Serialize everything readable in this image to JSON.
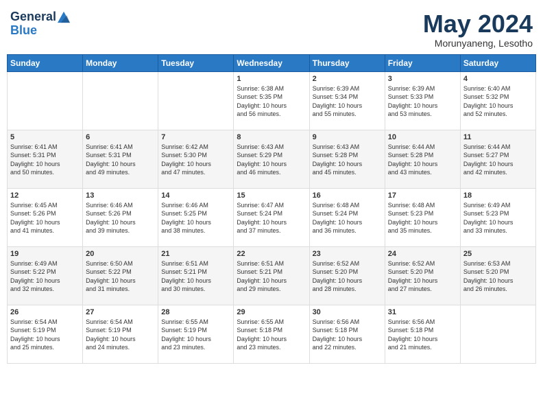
{
  "logo": {
    "line1": "General",
    "line2": "Blue"
  },
  "title": {
    "month_year": "May 2024",
    "location": "Morunyaneng, Lesotho"
  },
  "days_of_week": [
    "Sunday",
    "Monday",
    "Tuesday",
    "Wednesday",
    "Thursday",
    "Friday",
    "Saturday"
  ],
  "weeks": [
    [
      {
        "day": "",
        "info": ""
      },
      {
        "day": "",
        "info": ""
      },
      {
        "day": "",
        "info": ""
      },
      {
        "day": "1",
        "info": "Sunrise: 6:38 AM\nSunset: 5:35 PM\nDaylight: 10 hours\nand 56 minutes."
      },
      {
        "day": "2",
        "info": "Sunrise: 6:39 AM\nSunset: 5:34 PM\nDaylight: 10 hours\nand 55 minutes."
      },
      {
        "day": "3",
        "info": "Sunrise: 6:39 AM\nSunset: 5:33 PM\nDaylight: 10 hours\nand 53 minutes."
      },
      {
        "day": "4",
        "info": "Sunrise: 6:40 AM\nSunset: 5:32 PM\nDaylight: 10 hours\nand 52 minutes."
      }
    ],
    [
      {
        "day": "5",
        "info": "Sunrise: 6:41 AM\nSunset: 5:31 PM\nDaylight: 10 hours\nand 50 minutes."
      },
      {
        "day": "6",
        "info": "Sunrise: 6:41 AM\nSunset: 5:31 PM\nDaylight: 10 hours\nand 49 minutes."
      },
      {
        "day": "7",
        "info": "Sunrise: 6:42 AM\nSunset: 5:30 PM\nDaylight: 10 hours\nand 47 minutes."
      },
      {
        "day": "8",
        "info": "Sunrise: 6:43 AM\nSunset: 5:29 PM\nDaylight: 10 hours\nand 46 minutes."
      },
      {
        "day": "9",
        "info": "Sunrise: 6:43 AM\nSunset: 5:28 PM\nDaylight: 10 hours\nand 45 minutes."
      },
      {
        "day": "10",
        "info": "Sunrise: 6:44 AM\nSunset: 5:28 PM\nDaylight: 10 hours\nand 43 minutes."
      },
      {
        "day": "11",
        "info": "Sunrise: 6:44 AM\nSunset: 5:27 PM\nDaylight: 10 hours\nand 42 minutes."
      }
    ],
    [
      {
        "day": "12",
        "info": "Sunrise: 6:45 AM\nSunset: 5:26 PM\nDaylight: 10 hours\nand 41 minutes."
      },
      {
        "day": "13",
        "info": "Sunrise: 6:46 AM\nSunset: 5:26 PM\nDaylight: 10 hours\nand 39 minutes."
      },
      {
        "day": "14",
        "info": "Sunrise: 6:46 AM\nSunset: 5:25 PM\nDaylight: 10 hours\nand 38 minutes."
      },
      {
        "day": "15",
        "info": "Sunrise: 6:47 AM\nSunset: 5:24 PM\nDaylight: 10 hours\nand 37 minutes."
      },
      {
        "day": "16",
        "info": "Sunrise: 6:48 AM\nSunset: 5:24 PM\nDaylight: 10 hours\nand 36 minutes."
      },
      {
        "day": "17",
        "info": "Sunrise: 6:48 AM\nSunset: 5:23 PM\nDaylight: 10 hours\nand 35 minutes."
      },
      {
        "day": "18",
        "info": "Sunrise: 6:49 AM\nSunset: 5:23 PM\nDaylight: 10 hours\nand 33 minutes."
      }
    ],
    [
      {
        "day": "19",
        "info": "Sunrise: 6:49 AM\nSunset: 5:22 PM\nDaylight: 10 hours\nand 32 minutes."
      },
      {
        "day": "20",
        "info": "Sunrise: 6:50 AM\nSunset: 5:22 PM\nDaylight: 10 hours\nand 31 minutes."
      },
      {
        "day": "21",
        "info": "Sunrise: 6:51 AM\nSunset: 5:21 PM\nDaylight: 10 hours\nand 30 minutes."
      },
      {
        "day": "22",
        "info": "Sunrise: 6:51 AM\nSunset: 5:21 PM\nDaylight: 10 hours\nand 29 minutes."
      },
      {
        "day": "23",
        "info": "Sunrise: 6:52 AM\nSunset: 5:20 PM\nDaylight: 10 hours\nand 28 minutes."
      },
      {
        "day": "24",
        "info": "Sunrise: 6:52 AM\nSunset: 5:20 PM\nDaylight: 10 hours\nand 27 minutes."
      },
      {
        "day": "25",
        "info": "Sunrise: 6:53 AM\nSunset: 5:20 PM\nDaylight: 10 hours\nand 26 minutes."
      }
    ],
    [
      {
        "day": "26",
        "info": "Sunrise: 6:54 AM\nSunset: 5:19 PM\nDaylight: 10 hours\nand 25 minutes."
      },
      {
        "day": "27",
        "info": "Sunrise: 6:54 AM\nSunset: 5:19 PM\nDaylight: 10 hours\nand 24 minutes."
      },
      {
        "day": "28",
        "info": "Sunrise: 6:55 AM\nSunset: 5:19 PM\nDaylight: 10 hours\nand 23 minutes."
      },
      {
        "day": "29",
        "info": "Sunrise: 6:55 AM\nSunset: 5:18 PM\nDaylight: 10 hours\nand 23 minutes."
      },
      {
        "day": "30",
        "info": "Sunrise: 6:56 AM\nSunset: 5:18 PM\nDaylight: 10 hours\nand 22 minutes."
      },
      {
        "day": "31",
        "info": "Sunrise: 6:56 AM\nSunset: 5:18 PM\nDaylight: 10 hours\nand 21 minutes."
      },
      {
        "day": "",
        "info": ""
      }
    ]
  ]
}
